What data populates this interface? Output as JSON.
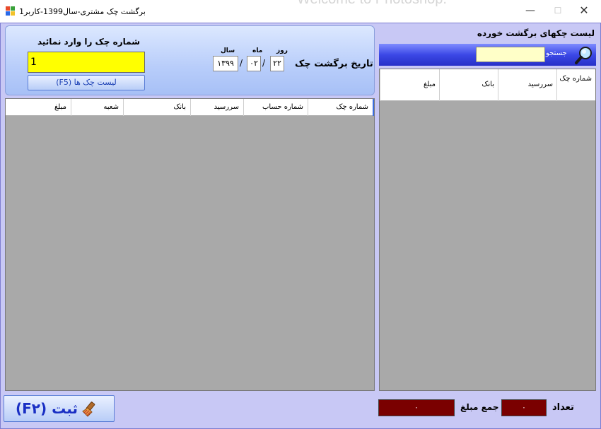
{
  "window": {
    "title": "برگشت چک مشتری-سال1399-کاربر1",
    "background_text": "Welcome to Photoshop.",
    "minimize_glyph": "—",
    "maximize_glyph": "☐",
    "close_glyph": "✕"
  },
  "check_entry": {
    "label": "شماره چک را وارد نمائید",
    "input_value": "1",
    "list_button_label": "لیست چک ها  (F5)"
  },
  "return_date": {
    "label": "تاریخ برگشت چک",
    "day_caption": "روز",
    "month_caption": "ماه",
    "year_caption": "سال",
    "day": "۲۲",
    "month": "۰۲",
    "year": "۱۳۹۹",
    "separator": "/"
  },
  "left_grid": {
    "columns": [
      "شماره چک",
      "شماره حساب",
      "سررسید",
      "بانک",
      "شعبه",
      "مبلغ"
    ]
  },
  "returned_checks": {
    "title": "لیست چکهای برگشت خورده",
    "search_label": "جستجو",
    "search_value": "",
    "columns": [
      "شماره چک",
      "سررسید",
      "بانک",
      "مبلغ"
    ]
  },
  "footer": {
    "save_label": "ثبت  (F۲)",
    "count_label": "تعداد",
    "count_value": "۰",
    "sum_label": "جمع مبلغ",
    "sum_value": "۰"
  },
  "colors": {
    "client_bg": "#c8c8f5",
    "grid_bg": "#a9a9a9",
    "input_yellow": "#ffff00",
    "total_box": "#7a0000",
    "search_bar": "#3b48e6"
  }
}
